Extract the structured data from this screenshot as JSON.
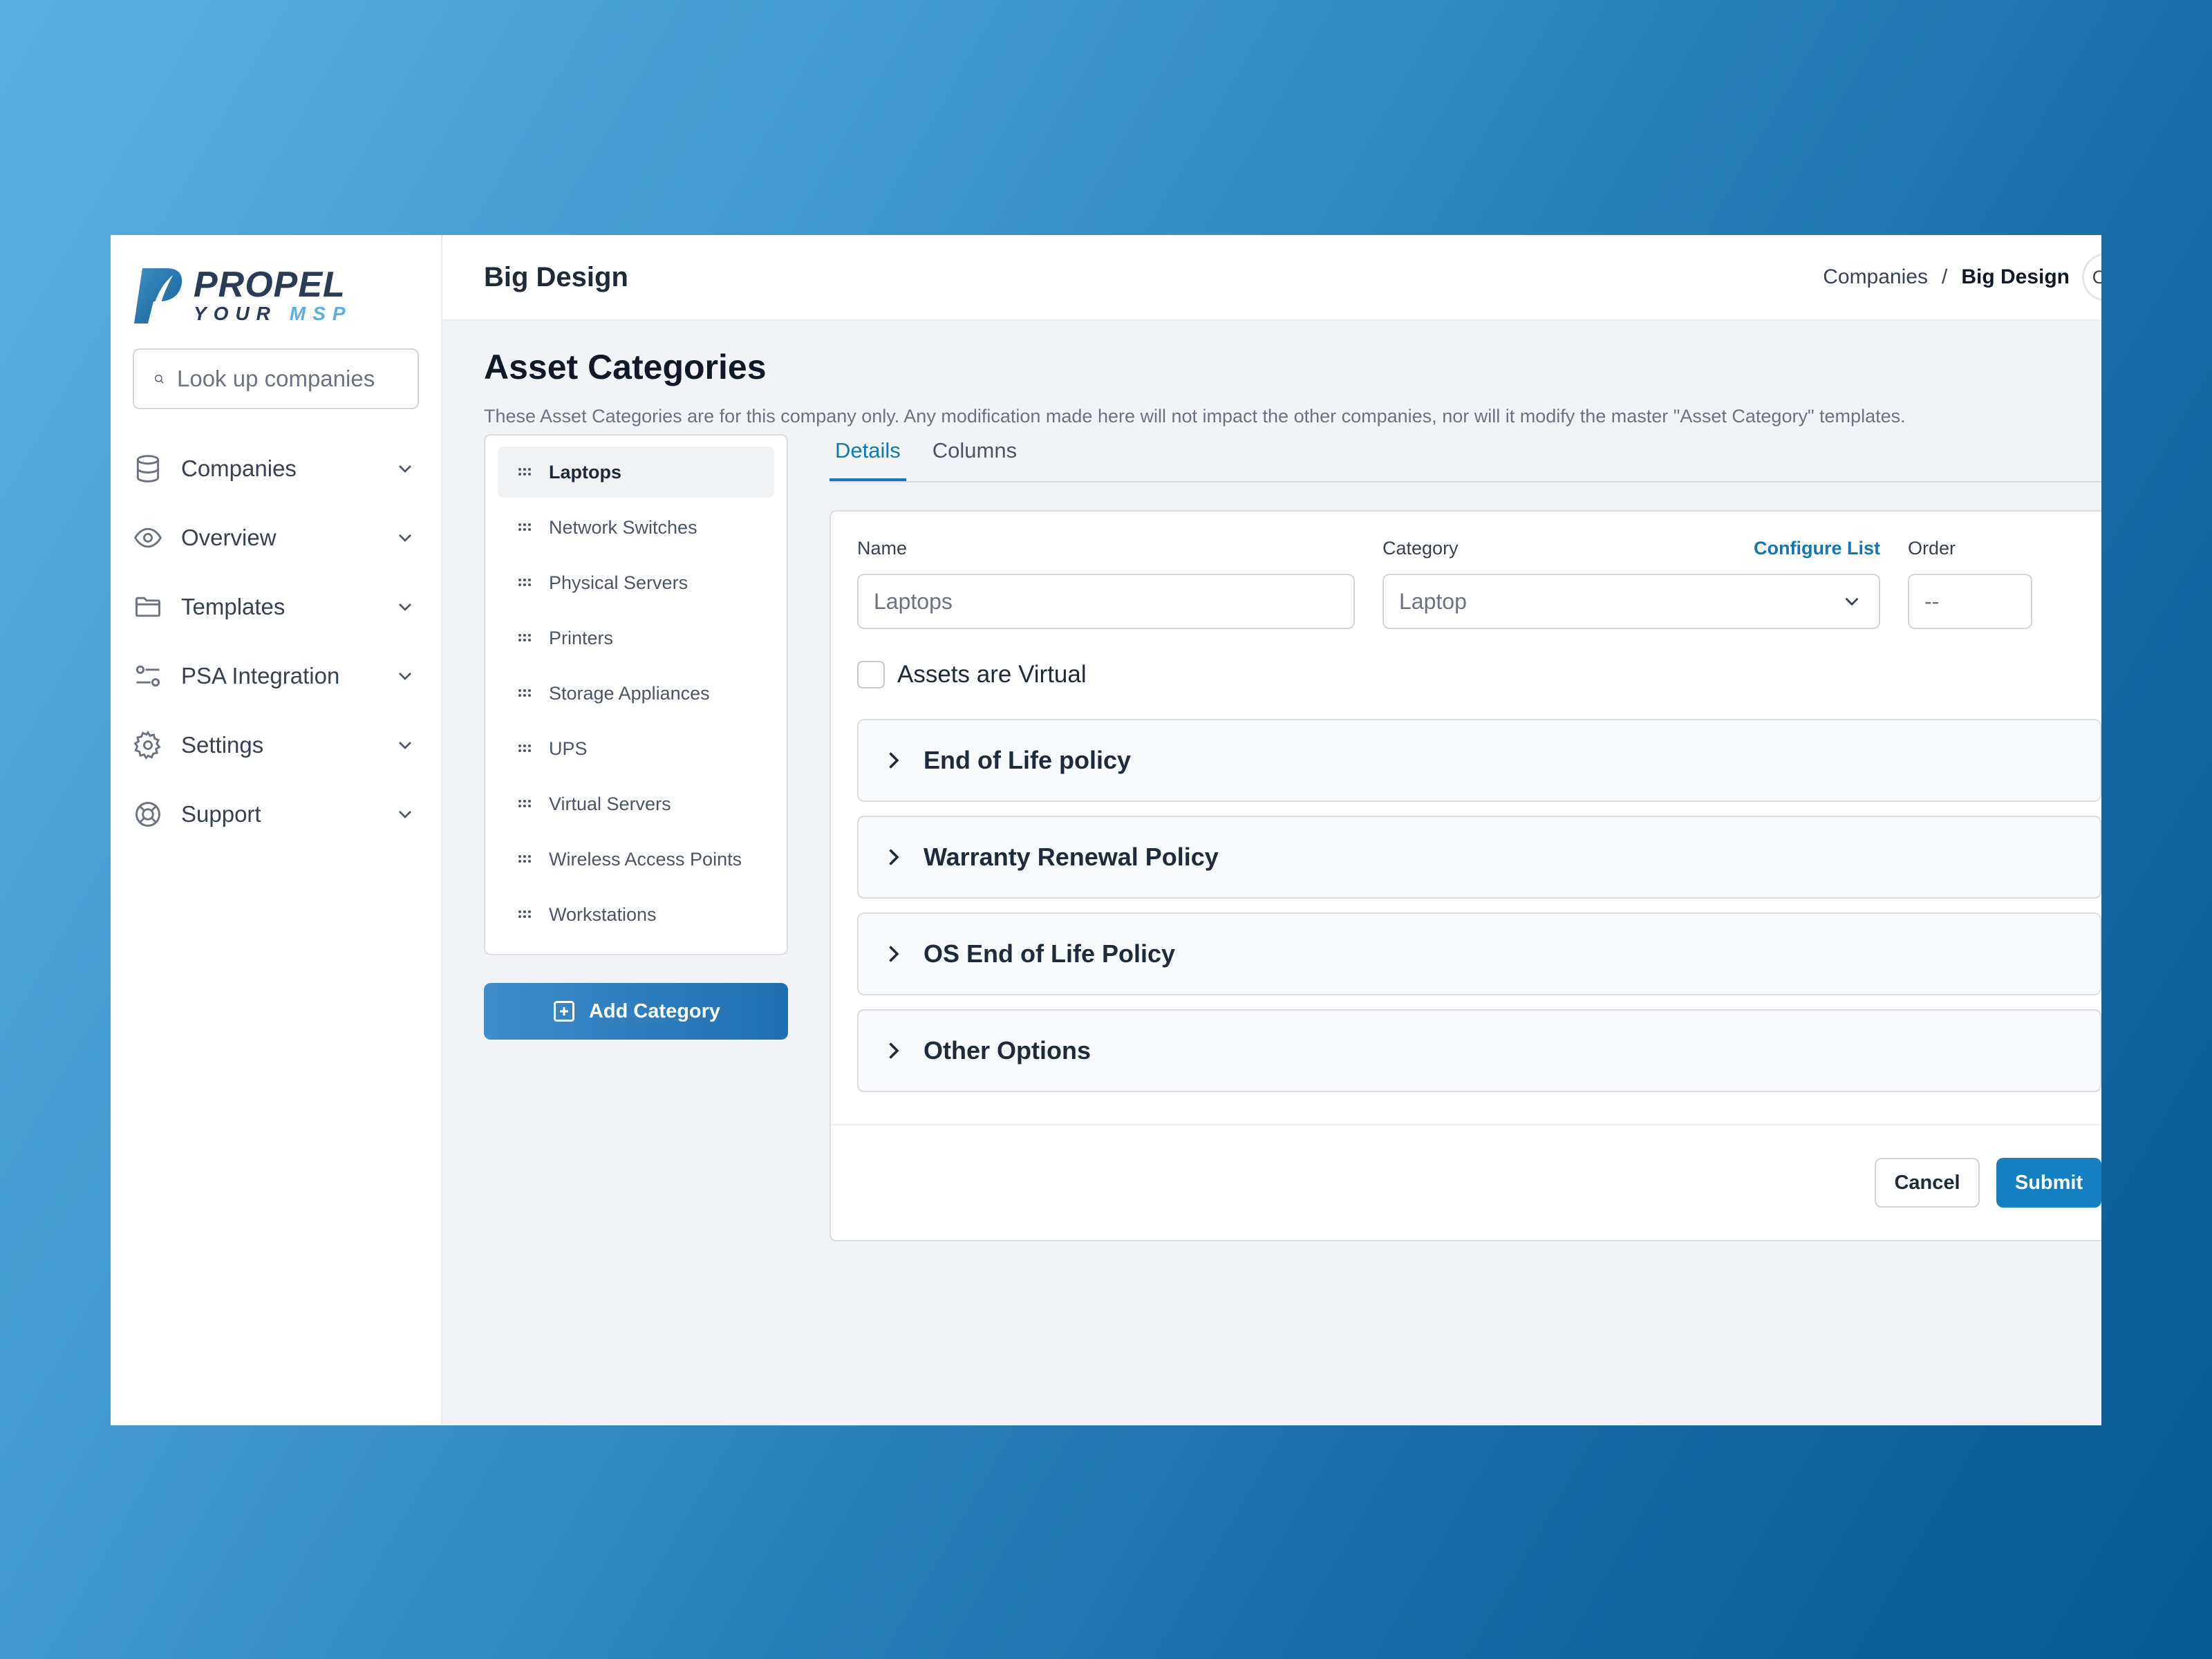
{
  "brand": {
    "main": "PROPEL",
    "sub_your": "YOUR",
    "sub_msp": "MSP"
  },
  "search": {
    "placeholder": "Look up companies"
  },
  "sidebar": {
    "items": [
      {
        "label": "Companies",
        "icon": "database-icon"
      },
      {
        "label": "Overview",
        "icon": "eye-icon"
      },
      {
        "label": "Templates",
        "icon": "folder-icon"
      },
      {
        "label": "PSA Integration",
        "icon": "sliders-icon"
      },
      {
        "label": "Settings",
        "icon": "gear-icon"
      },
      {
        "label": "Support",
        "icon": "lifebuoy-icon"
      }
    ]
  },
  "header": {
    "title": "Big Design",
    "breadcrumb": {
      "parent": "Companies",
      "separator": "/",
      "current": "Big Design"
    },
    "avatar_initials": "OR"
  },
  "page": {
    "title": "Asset Categories",
    "description": "These Asset Categories are for this company only. Any modification made here will not impact the other companies, nor will it modify the master \"Asset Category\" templates."
  },
  "categories": [
    "Laptops",
    "Network Switches",
    "Physical Servers",
    "Printers",
    "Storage Appliances",
    "UPS",
    "Virtual Servers",
    "Wireless Access Points",
    "Workstations"
  ],
  "active_category": "Laptops",
  "add_category_label": "Add Category",
  "tabs": [
    {
      "label": "Details",
      "active": true
    },
    {
      "label": "Columns",
      "active": false
    }
  ],
  "form": {
    "name_label": "Name",
    "name_value": "Laptops",
    "category_label": "Category",
    "configure_list_label": "Configure List",
    "category_value": "Laptop",
    "order_label": "Order",
    "order_placeholder": "--",
    "virtual_label": "Assets are Virtual",
    "virtual_checked": false,
    "sections": [
      "End of Life policy",
      "Warranty Renewal Policy",
      "OS End of Life Policy",
      "Other Options"
    ],
    "cancel_label": "Cancel",
    "submit_label": "Submit"
  },
  "colors": {
    "accent": "#1177b6",
    "submit": "#1480c2",
    "brand_dark": "#2b3a55",
    "brand_light": "#5aaee0"
  }
}
